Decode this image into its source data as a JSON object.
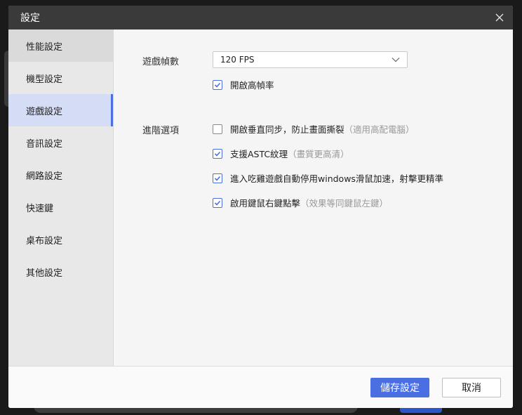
{
  "dialog": {
    "title": "設定",
    "close_icon": "close-icon"
  },
  "sidebar": {
    "items": [
      {
        "label": "性能設定"
      },
      {
        "label": "機型設定"
      },
      {
        "label": "遊戲設定"
      },
      {
        "label": "音訊設定"
      },
      {
        "label": "網路設定"
      },
      {
        "label": "快速鍵"
      },
      {
        "label": "桌布設定"
      },
      {
        "label": "其他設定"
      }
    ],
    "active_index": 2
  },
  "game": {
    "fps_label": "遊戲幀數",
    "fps_value": "120 FPS",
    "high_fps": {
      "label": "開啟高幀率",
      "checked": true
    },
    "advanced_label": "進階選項",
    "options": [
      {
        "label": "開啟垂直同步，防止畫面撕裂",
        "hint": "（適用高配電腦）",
        "checked": false
      },
      {
        "label": "支援ASTC紋理",
        "hint": "（畫質更高清）",
        "checked": true
      },
      {
        "label": "進入吃雞遊戲自動停用windows滑鼠加速，射擊更精準",
        "hint": "",
        "checked": true
      },
      {
        "label": "啟用鍵鼠右鍵點擊",
        "hint": "（效果等同鍵鼠左鍵）",
        "checked": true
      }
    ]
  },
  "footer": {
    "save_label": "儲存設定",
    "cancel_label": "取消"
  },
  "colors": {
    "accent": "#4a6fe3",
    "titlebar": "#3a3a3a",
    "active_item_bg": "#d5dcf5"
  }
}
